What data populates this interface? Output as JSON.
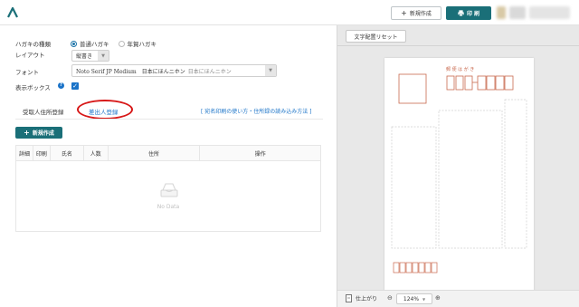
{
  "topbar": {
    "new_label": "新規作成",
    "print_label": "印 刷"
  },
  "form": {
    "postcard_type_label": "ハガキの種類",
    "options": [
      "普通ハガキ",
      "年賀ハガキ"
    ],
    "layout_label": "レイアウト",
    "layout_value": "縦書き",
    "font_label": "フォント",
    "font_value": "Noto Serif JP Medium　日本にほんニホン",
    "font_sample": "日本にほんニホン",
    "display_box_label": "表示ボックス",
    "help_mark": "?"
  },
  "tabs": {
    "recipient": "受取人住所登録",
    "sender": "差出人登録",
    "help_link": "[ 宛名印刷の使い方・住所録の読み込み方法 ]"
  },
  "table": {
    "add_button": "新規作成",
    "headers": [
      "詳細",
      "印刷",
      "氏名",
      "人数",
      "住所",
      "操作"
    ],
    "empty_text": "No Data"
  },
  "preview": {
    "reset_button": "文字配置リセット",
    "finish_label": "仕上がり",
    "zoom": "124%",
    "card_header_text": "郵 便 は が き"
  },
  "colors": {
    "accent": "#1a6f78",
    "annotation": "#d71818",
    "stamp": "#c96a4f"
  }
}
